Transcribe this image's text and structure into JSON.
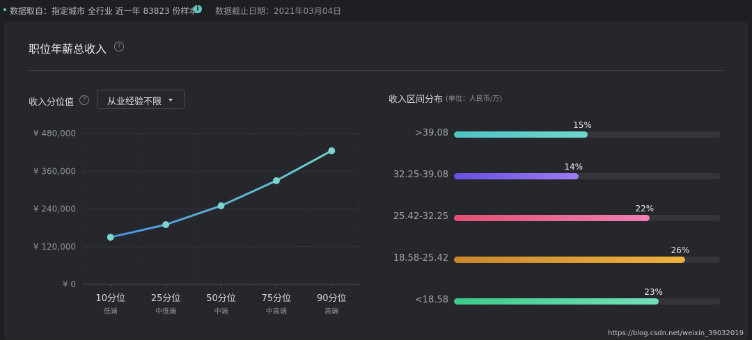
{
  "topbar": {
    "source_text": "数据取自：指定城市 全行业 近一年 83823 份样本",
    "info_icon": "i",
    "date_text": "数据截止日期：2021年03月04日"
  },
  "card": {
    "title": "职位年薪总收入",
    "help_icon": "?"
  },
  "percentile": {
    "title": "收入分位值",
    "help_icon": "?",
    "select_value": "从业经验不限"
  },
  "distribution": {
    "title": "收入区间分布",
    "unit": "(单位：人民币/万)"
  },
  "colors": {
    "line_start": "#4a8fe6",
    "line_end": "#6fd2c9",
    "point": "#7bd6cd",
    "bar_gradients": [
      [
        "#4fc3c0",
        "#6fd6cf"
      ],
      [
        "#6a4fe0",
        "#9a7df2"
      ],
      [
        "#e2506f",
        "#f07fb6"
      ],
      [
        "#c9872a",
        "#f0b23c"
      ],
      [
        "#3fc98a",
        "#72e0b8"
      ]
    ]
  },
  "chart_data": [
    {
      "type": "line",
      "title": "",
      "categories": [
        "10分位",
        "25分位",
        "50分位",
        "75分位",
        "90分位"
      ],
      "sublabels": [
        "低端",
        "中低端",
        "中端",
        "中高端",
        "高端"
      ],
      "values": [
        150000,
        190000,
        250000,
        330000,
        425000
      ],
      "ylim": [
        0,
        480000
      ],
      "yticks": [
        0,
        120000,
        240000,
        360000,
        480000
      ],
      "ytick_labels": [
        "¥ 0",
        "¥ 120,000",
        "¥ 240,000",
        "¥ 360,000",
        "¥ 480,000"
      ],
      "grid": true
    },
    {
      "type": "bar",
      "orientation": "horizontal",
      "title": "收入区间分布",
      "categories": [
        ">39.08",
        "32.25-39.08",
        "25.42-32.25",
        "18.58-25.42",
        "<18.58"
      ],
      "values": [
        15,
        14,
        22,
        26,
        23
      ],
      "value_labels": [
        "15%",
        "14%",
        "22%",
        "26%",
        "23%"
      ],
      "xlim": [
        0,
        30
      ]
    }
  ],
  "watermark": "https://blog.csdn.net/weixin_39032019"
}
